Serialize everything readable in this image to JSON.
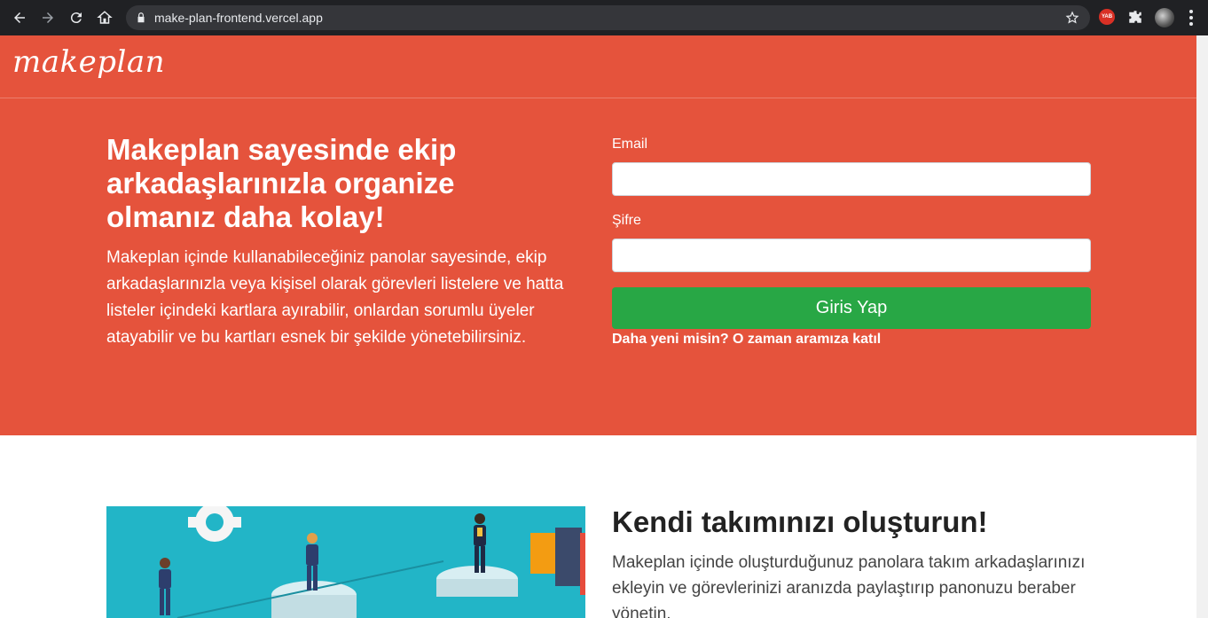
{
  "browser": {
    "url": "make-plan-frontend.vercel.app",
    "extension_badge": "YAB",
    "icons": [
      "back-arrow-icon",
      "forward-arrow-icon",
      "reload-icon",
      "home-icon",
      "lock-icon",
      "star-icon",
      "puzzle-icon",
      "kebab-menu-icon"
    ]
  },
  "header": {
    "logo": "makeplan"
  },
  "hero": {
    "title": "Makeplan sayesinde ekip arkadaşlarınızla organize olmanız daha kolay!",
    "text": "Makeplan içinde kullanabileceğiniz panolar sayesinde, ekip arkadaşlarınızla veya kişisel olarak görevleri listelere ve hatta listeler içindeki kartlara ayırabilir, onlardan sorumlu üyeler atayabilir ve bu kartları esnek bir şekilde yönetebilirsiniz."
  },
  "login": {
    "email_label": "Email",
    "email_value": "",
    "password_label": "Şifre",
    "password_value": "",
    "submit_label": "Giris Yap",
    "signup_link": "Daha yeni misin? O zaman aramıza katıl"
  },
  "feature": {
    "title": "Kendi takımınızı oluşturun!",
    "text": "Makeplan içinde oluşturduğunuz panolara takım arkadaşlarınızı ekleyin ve görevlerinizi aranızda paylaştırıp panonuzu beraber yönetin."
  },
  "colors": {
    "brand": "#e5533c",
    "button": "#28a745",
    "illustration_bg": "#22b5c7"
  }
}
